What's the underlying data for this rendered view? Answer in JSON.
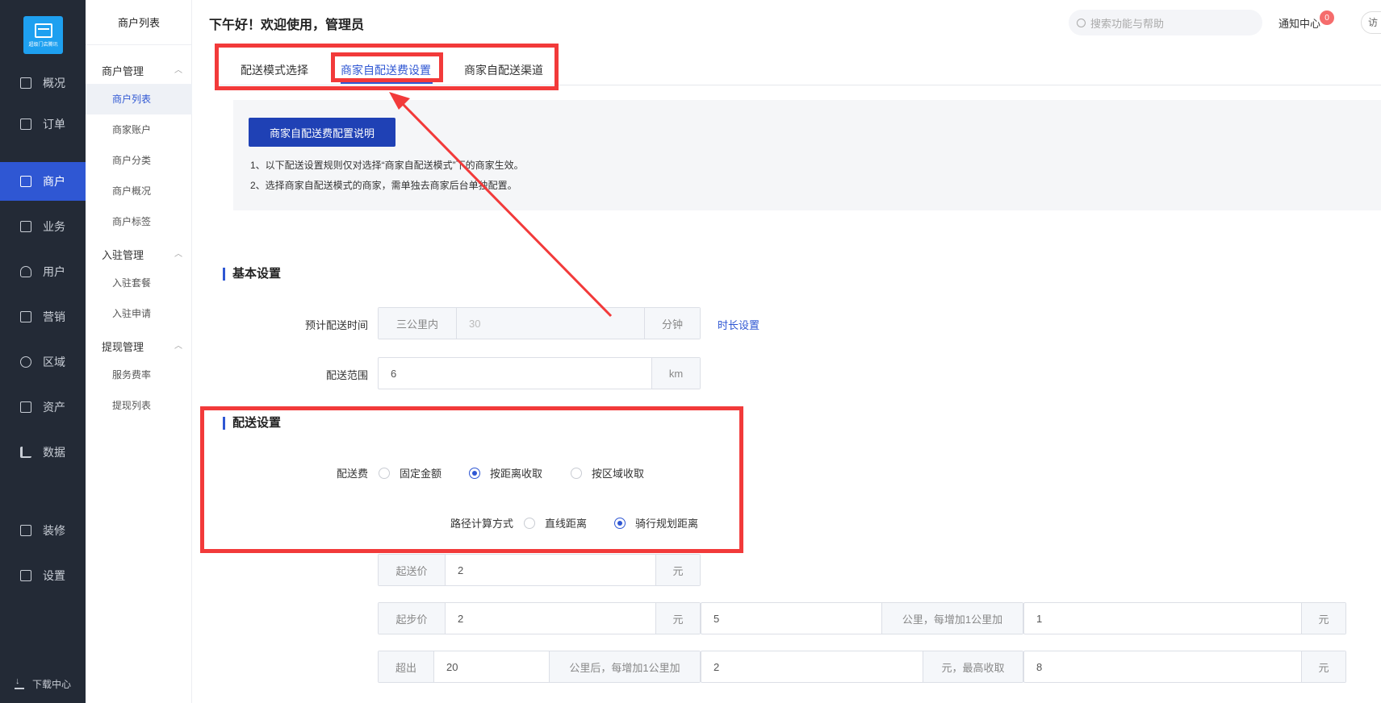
{
  "sidebar": {
    "logo_text": "超级门店腾讯",
    "items": [
      {
        "label": "概况",
        "icon": "presentation-icon"
      },
      {
        "label": "订单",
        "icon": "document-icon"
      },
      {
        "label": "商户",
        "icon": "store-icon"
      },
      {
        "label": "业务",
        "icon": "business-icon"
      },
      {
        "label": "用户",
        "icon": "user-icon"
      },
      {
        "label": "营销",
        "icon": "marketing-icon"
      },
      {
        "label": "区域",
        "icon": "database-icon"
      },
      {
        "label": "资产",
        "icon": "asset-icon"
      },
      {
        "label": "数据",
        "icon": "bar-chart-icon"
      },
      {
        "label": "装修",
        "icon": "shopping-bag-icon"
      },
      {
        "label": "设置",
        "icon": "settings-icon"
      }
    ],
    "active": "商户",
    "download": "下载中心"
  },
  "submenu": {
    "title": "商户列表",
    "groups": [
      {
        "label": "商户管理",
        "items": [
          "商户列表",
          "商家账户",
          "商户分类",
          "商户概况",
          "商户标签"
        ]
      },
      {
        "label": "入驻管理",
        "items": [
          "入驻套餐",
          "入驻申请"
        ]
      },
      {
        "label": "提现管理",
        "items": [
          "服务费率",
          "提现列表"
        ]
      }
    ],
    "active": "商户列表"
  },
  "header": {
    "greeting": "下午好！欢迎使用，管理员",
    "search_placeholder": "搜索功能与帮助",
    "notify": "通知中心",
    "notify_count": "0",
    "visit": "访"
  },
  "tabs": {
    "items": [
      "配送模式选择",
      "商家自配送费设置",
      "商家自配送渠道"
    ],
    "active": "商家自配送费设置"
  },
  "info": {
    "button": "商家自配送费配置说明",
    "line1": "1、以下配送设置规则仅对选择“商家自配送模式”下的商家生效。",
    "line2": "2、选择商家自配送模式的商家，需单独去商家后台单独配置。"
  },
  "basic": {
    "title": "基本设置",
    "time_label": "预计配送时间",
    "time_prefix": "三公里内",
    "time_value": "30",
    "time_unit": "分钟",
    "time_link": "时长设置",
    "range_label": "配送范围",
    "range_value": "6",
    "range_unit": "km"
  },
  "delivery": {
    "title": "配送设置",
    "fee_label": "配送费",
    "fee_options": [
      "固定金额",
      "按距离收取",
      "按区域收取"
    ],
    "fee_selected": "按距离收取",
    "route_label": "路径计算方式",
    "route_options": [
      "直线距离",
      "骑行规划距离"
    ],
    "route_selected": "骑行规划距离",
    "min_order_label": "起送价",
    "min_order_value": "2",
    "yuan": "元",
    "start_label": "起步价",
    "start_value": "2",
    "start_km": "5",
    "per_km_text": "公里，每增加1公里加",
    "per_km_value": "1",
    "over_label": "超出",
    "over_km": "20",
    "over_text": "公里后，每增加1公里加",
    "over_add": "2",
    "max_text": "元，最高收取",
    "max_value": "8"
  },
  "colors": {
    "accent": "#2f57d3",
    "sidebar_bg": "#232a36",
    "annotation": "#f23a3a"
  }
}
